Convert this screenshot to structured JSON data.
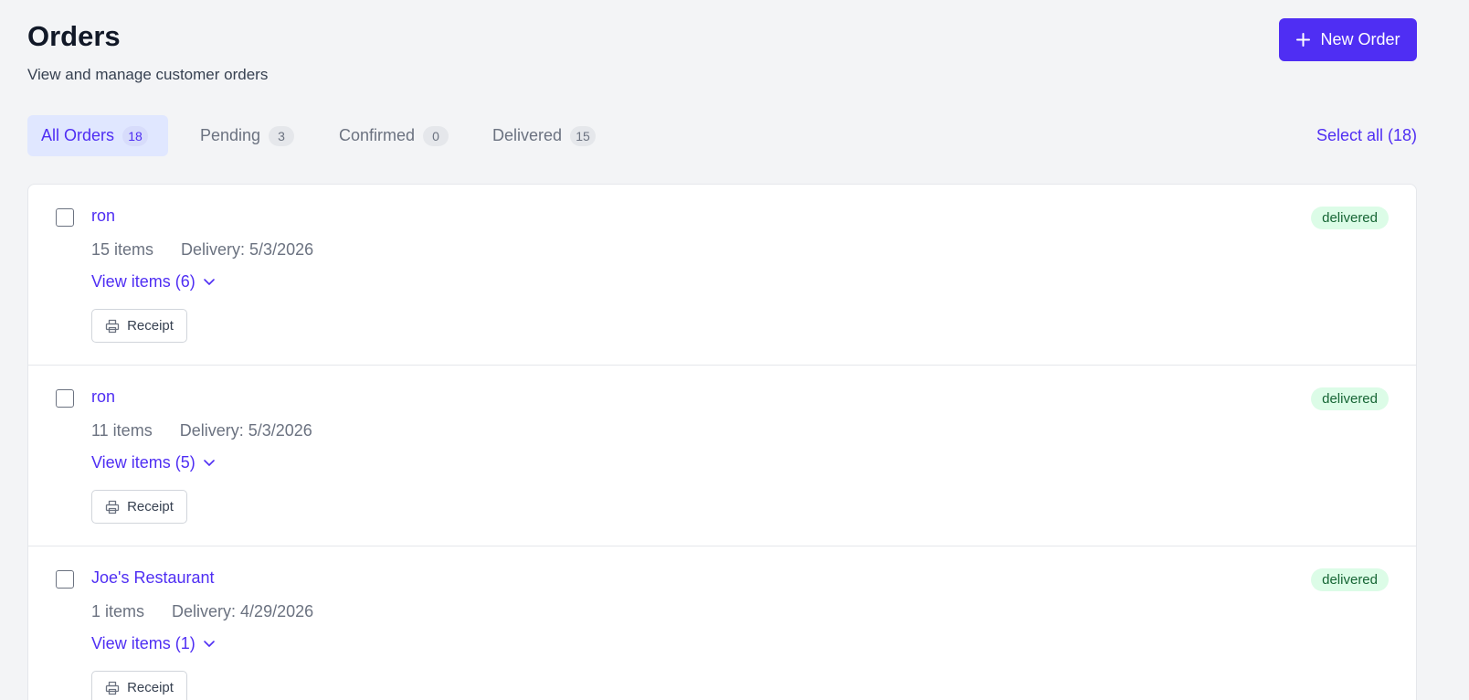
{
  "header": {
    "title": "Orders",
    "subtitle": "View and manage customer orders",
    "new_order_label": "New Order"
  },
  "tabs": [
    {
      "label": "All Orders",
      "count": "18",
      "active": true
    },
    {
      "label": "Pending",
      "count": "3",
      "active": false
    },
    {
      "label": "Confirmed",
      "count": "0",
      "active": false
    },
    {
      "label": "Delivered",
      "count": "15",
      "active": false
    }
  ],
  "select_all_label": "Select all (18)",
  "orders": [
    {
      "customer": "ron",
      "items": "15 items",
      "delivery": "Delivery: 5/3/2026",
      "view_items": "View items (6)",
      "receipt_label": "Receipt",
      "status": "delivered"
    },
    {
      "customer": "ron",
      "items": "11 items",
      "delivery": "Delivery: 5/3/2026",
      "view_items": "View items (5)",
      "receipt_label": "Receipt",
      "status": "delivered"
    },
    {
      "customer": "Joe's Restaurant",
      "items": "1 items",
      "delivery": "Delivery: 4/29/2026",
      "view_items": "View items (1)",
      "receipt_label": "Receipt",
      "status": "delivered"
    }
  ],
  "icons": {
    "new_order": "plus-icon",
    "view_items": "chevron-down-icon",
    "receipt": "printer-icon"
  },
  "colors": {
    "accent": "#4f2ef3",
    "active_tab_bg": "#e0e7ff",
    "status_bg": "#dcfce7",
    "status_text": "#166534",
    "page_bg": "#f3f4f6"
  }
}
